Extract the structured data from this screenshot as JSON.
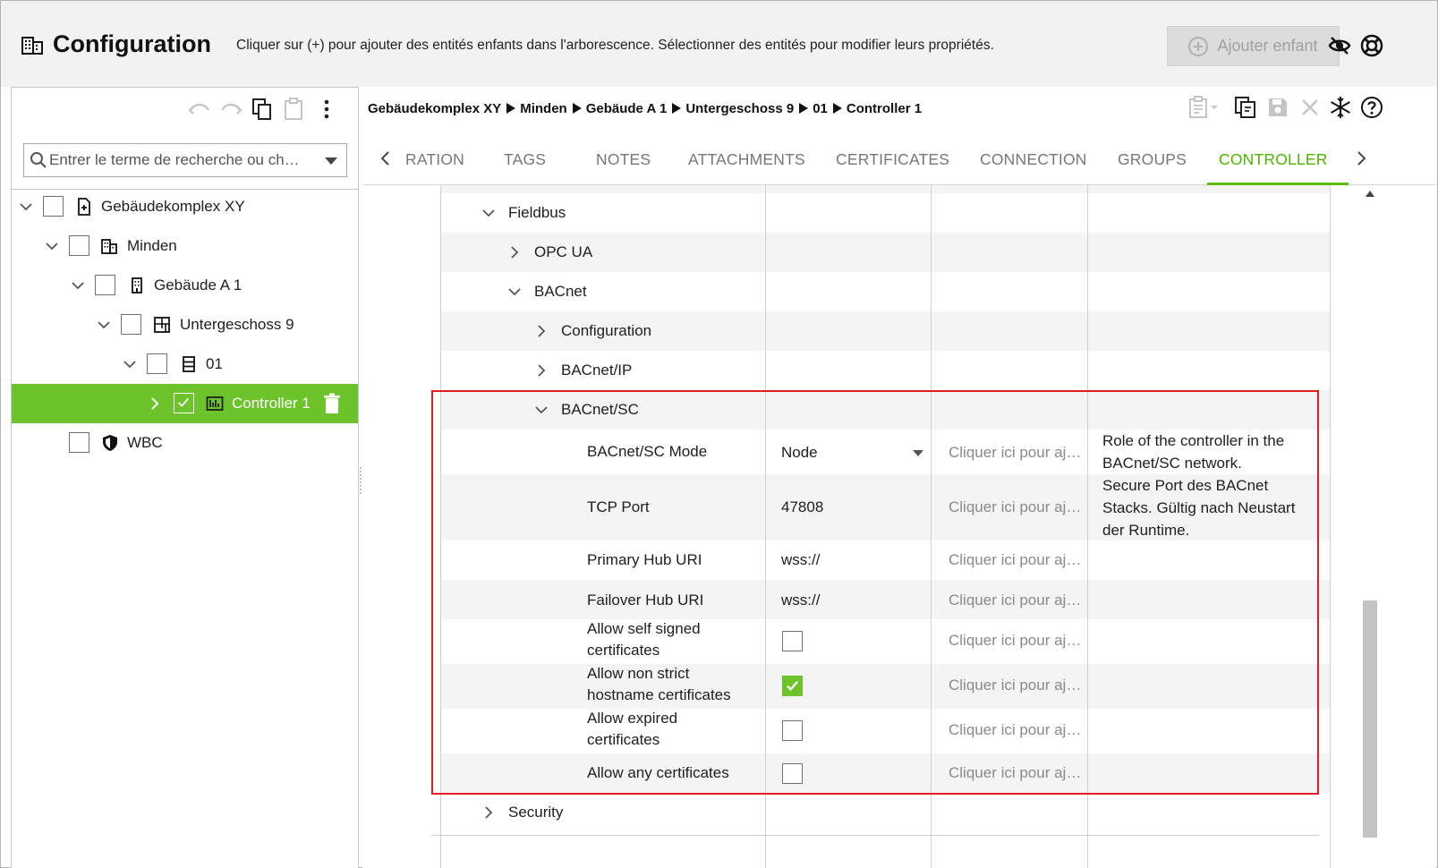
{
  "header": {
    "title": "Configuration",
    "description": "Cliquer sur (+) pour ajouter des entités enfants dans l'arborescence. Sélectionner des entités pour modifier leurs propriétés.",
    "add_child_label": "Ajouter enfant"
  },
  "left": {
    "search_placeholder": "Entrer le terme de recherche ou ch…",
    "tree": [
      {
        "label": "Gebäudekomplex XY",
        "icon": "building-complex-icon"
      },
      {
        "label": "Minden",
        "icon": "city-icon"
      },
      {
        "label": "Gebäude A 1",
        "icon": "building-icon"
      },
      {
        "label": "Untergeschoss 9",
        "icon": "floor-plan-icon"
      },
      {
        "label": "01",
        "icon": "cabinet-icon"
      },
      {
        "label": "Controller 1",
        "icon": "controller-icon"
      },
      {
        "label": "WBC",
        "icon": "shield-icon"
      }
    ]
  },
  "breadcrumb": [
    "Gebäudekomplex XY",
    "Minden",
    "Gebäude A 1",
    "Untergeschoss 9",
    "01",
    "Controller 1"
  ],
  "tabs": [
    "RATION",
    "TAGS",
    "NOTES",
    "ATTACHMENTS",
    "CERTIFICATES",
    "CONNECTION",
    "GROUPS",
    "CONTROLLER"
  ],
  "active_tab": "CONTROLLER",
  "grid": {
    "groups": {
      "fieldbus": "Fieldbus",
      "opcua": "OPC UA",
      "bacnet": "BACnet",
      "configuration": "Configuration",
      "bacnet_ip": "BACnet/IP",
      "bacnet_sc": "BACnet/SC",
      "security": "Security"
    },
    "placeholder": "Cliquer ici pour aj…",
    "rows": [
      {
        "name": "BACnet/SC Mode",
        "value": "Node",
        "desc": "Role of the controller in the BACnet/SC network."
      },
      {
        "name": "TCP Port",
        "value": "47808",
        "desc": "Secure Port des BACnet Stacks. Gültig nach Neustart der Runtime."
      },
      {
        "name": "Primary Hub URI",
        "value": "wss://",
        "desc": ""
      },
      {
        "name": "Failover Hub URI",
        "value": "wss://",
        "desc": ""
      },
      {
        "name_line1": "Allow self signed",
        "name_line2": "certificates",
        "checked": false
      },
      {
        "name_line1": "Allow non strict",
        "name_line2": "hostname certificates",
        "checked": true
      },
      {
        "name_line1": "Allow expired",
        "name_line2": "certificates",
        "checked": false
      },
      {
        "name": "Allow any certificates",
        "checked": false
      }
    ]
  },
  "colors": {
    "accent_green": "#6cc42a",
    "tab_active": "#4fb300",
    "highlight_red": "#e31b23"
  }
}
